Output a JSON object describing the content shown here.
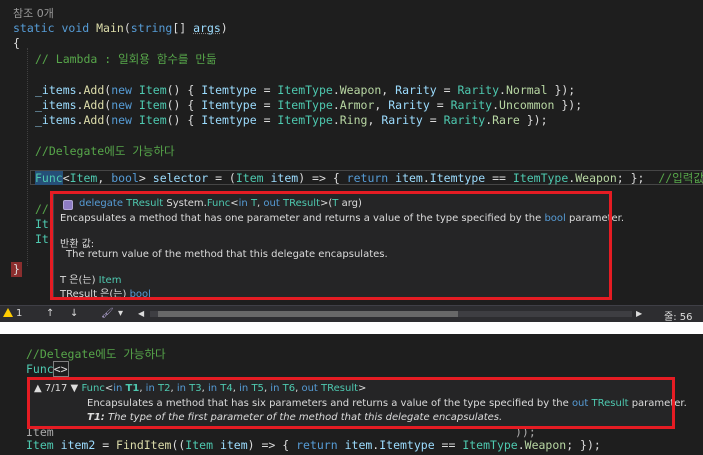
{
  "top_editor": {
    "codelens": "참조 0개",
    "lines": {
      "signature": {
        "static_kw": "static",
        "void_kw": "void",
        "method": "Main",
        "param_open": "(",
        "string_kw": "string",
        "param_rest": "[] ",
        "args": "args",
        "param_close": ")"
      },
      "brace_open": "{",
      "comment_lambda": "// Lambda : 일회용 함수를 만듦",
      "add_lines": [
        {
          "obj": "_items",
          "call": ".",
          "add": "Add",
          "open": "(",
          "new_kw": "new",
          "sp": " ",
          "item_type": "Item",
          "mid1": "() { ",
          "prop1": "Itemtype",
          "eq1": " = ",
          "enum1": "ItemType",
          "dot1": ".",
          "val1": "Weapon",
          "comma": ", ",
          "prop2": "Rarity",
          "eq2": " = ",
          "enum2": "Rarity",
          "dot2": ".",
          "val2": "Normal",
          "end": " });"
        },
        {
          "obj": "_items",
          "call": ".",
          "add": "Add",
          "open": "(",
          "new_kw": "new",
          "sp": " ",
          "item_type": "Item",
          "mid1": "() { ",
          "prop1": "Itemtype",
          "eq1": " = ",
          "enum1": "ItemType",
          "dot1": ".",
          "val1": "Armor",
          "comma": ", ",
          "prop2": "Rarity",
          "eq2": " = ",
          "enum2": "Rarity",
          "dot2": ".",
          "val2": "Uncommon",
          "end": " });"
        },
        {
          "obj": "_items",
          "call": ".",
          "add": "Add",
          "open": "(",
          "new_kw": "new",
          "sp": " ",
          "item_type": "Item",
          "mid1": "() { ",
          "prop1": "Itemtype",
          "eq1": " = ",
          "enum1": "ItemType",
          "dot1": ".",
          "val1": "Ring",
          "comma": ", ",
          "prop2": "Rarity",
          "eq2": " = ",
          "enum2": "Rarity",
          "dot2": ".",
          "val2": "Rare",
          "end": " });"
        }
      ],
      "comment_delegate": "//Delegate에도 가능하다",
      "func_line": {
        "func": "Func",
        "lt": "<",
        "item": "Item",
        "comma": ", ",
        "bool": "bool",
        "gt": "> ",
        "selector": "selector",
        "eq": " = (",
        "item2": "Item",
        "sp": " ",
        "item_var": "item",
        "arrow": ") => { ",
        "return_kw": "return",
        "sp2": " ",
        "item_var2": "item",
        "dot": ".",
        "prop": "Itemtype",
        "eqeq": " == ",
        "enum": "ItemType",
        "dot2": ".",
        "val": "Weapon",
        "end": "; };  ",
        "comment": "//입력값과 반환값"
      },
      "partial_comment": "//",
      "partial_it1": "It",
      "partial_it2": "It",
      "brace_close": "}"
    }
  },
  "top_tooltip": {
    "header": {
      "delegate_kw": "delegate",
      "sp1": " ",
      "ret_type": "TResult",
      "sp2": " ",
      "ns": "System.",
      "func": "Func",
      "lt": "<",
      "in_kw": "in",
      "sp3": " ",
      "t": "T",
      "comma": ", ",
      "out_kw": "out",
      "sp4": " ",
      "tresult": "TResult",
      "gt": ">(",
      "targ": "T",
      "sp5": " ",
      "arg": "arg",
      "close": ")"
    },
    "description_pre": "Encapsulates a method that has one parameter and returns a value of the type specified by the ",
    "description_bool": "bool",
    "description_post": " parameter.",
    "returns_label": "반환 값:",
    "returns_text": "The return value of the method that this delegate encapsulates.",
    "t_label": "T 은(는) ",
    "t_value": "Item",
    "tresult_label": "TResult 은(는) ",
    "tresult_value": "bool"
  },
  "status_bar": {
    "warnings": "1",
    "up_arrow": "↑",
    "down_arrow": "↓",
    "brush": "🖌",
    "dropdown": "▾",
    "scroll_left": "◀",
    "scroll_right": "▶",
    "line_label": "줄: 56"
  },
  "bottom_editor": {
    "comment": "//Delegate에도 가능하다",
    "func_text": "Func",
    "func_brackets": "<>",
    "hidden_line_left": "Item ",
    "hidden_line_right": "));",
    "item2_line": {
      "item": "Item",
      "sp": " ",
      "var": "item2",
      "eq": " = ",
      "method": "FindItem",
      "open": "((",
      "item_type": "Item",
      "sp2": " ",
      "p": "item",
      "arrow": ") => { ",
      "return_kw": "return",
      "sp3": " ",
      "p2": "item",
      "dot": ".",
      "prop": "Itemtype",
      "eqeq": " == ",
      "enum": "ItemType",
      "dot2": ".",
      "val": "Weapon",
      "end": "; });"
    }
  },
  "bottom_tooltip": {
    "overload": "7/17",
    "up": "▲",
    "down": "▼",
    "func": "Func",
    "lt": "<",
    "params": [
      {
        "kw": "in",
        "name": "T1",
        "sep": ", "
      },
      {
        "kw": "in",
        "name": "T2",
        "sep": ", "
      },
      {
        "kw": "in",
        "name": "T3",
        "sep": ", "
      },
      {
        "kw": "in",
        "name": "T4",
        "sep": ", "
      },
      {
        "kw": "in",
        "name": "T5",
        "sep": ", "
      },
      {
        "kw": "in",
        "name": "T6",
        "sep": ", "
      }
    ],
    "out_kw": "out",
    "tresult": "TResult",
    "gt": ">",
    "description_pre": "Encapsulates a method that has six parameters and returns a value of the type specified by the ",
    "description_out": "out",
    "description_tresult": "TResult",
    "description_post": " parameter.",
    "param_doc_name": "T1:",
    "param_doc_text": " The type of the first parameter of the method that this delegate encapsulates."
  }
}
